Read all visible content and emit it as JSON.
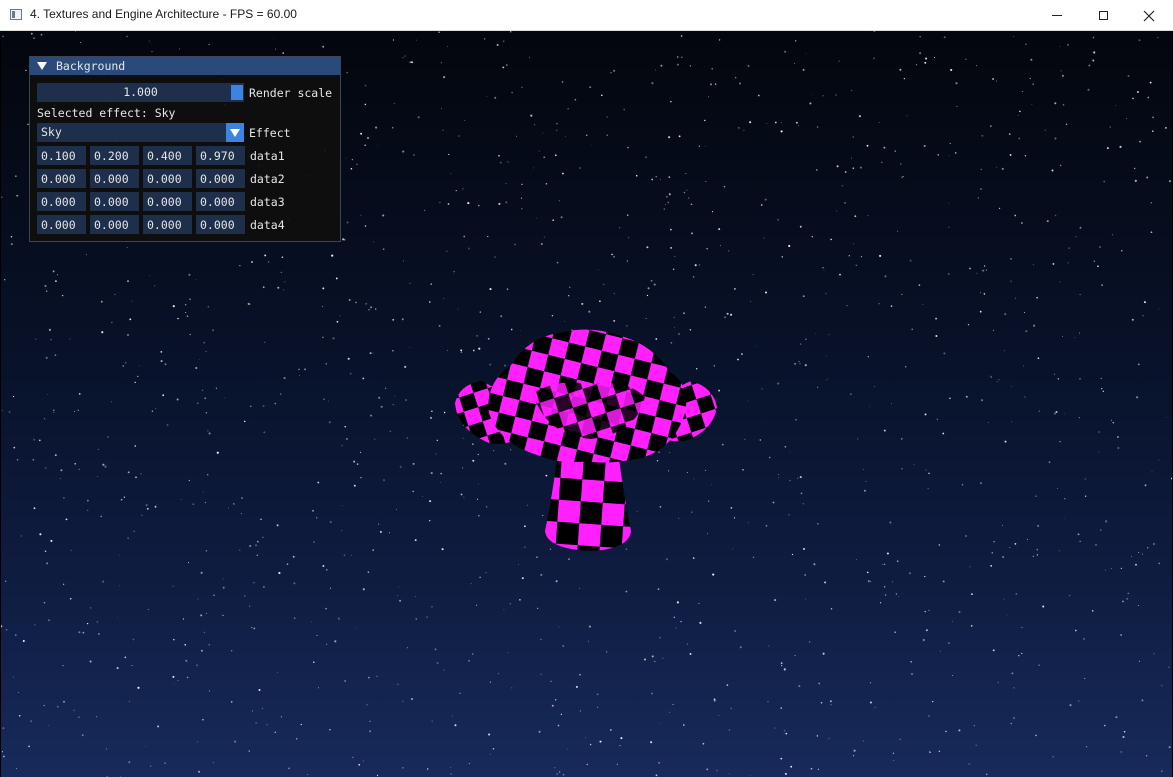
{
  "window": {
    "title": "4. Textures and Engine Architecture - FPS = 60.00",
    "minimize_glyph": "—",
    "close_glyph": "✕"
  },
  "panel": {
    "title": "Background",
    "render_scale": {
      "value": "1.000",
      "label": "Render scale",
      "fraction": 1.0
    },
    "selected_effect_text": "Selected effect: Sky",
    "effect": {
      "value": "Sky",
      "label": "Effect"
    },
    "data_rows": [
      {
        "label": "data1",
        "values": [
          "0.100",
          "0.200",
          "0.400",
          "0.970"
        ]
      },
      {
        "label": "data2",
        "values": [
          "0.000",
          "0.000",
          "0.000",
          "0.000"
        ]
      },
      {
        "label": "data3",
        "values": [
          "0.000",
          "0.000",
          "0.000",
          "0.000"
        ]
      },
      {
        "label": "data4",
        "values": [
          "0.000",
          "0.000",
          "0.000",
          "0.000"
        ]
      }
    ]
  },
  "scene": {
    "object": "checkered mushroom mesh",
    "checker_colors": [
      "#ff1fff",
      "#000000"
    ]
  }
}
